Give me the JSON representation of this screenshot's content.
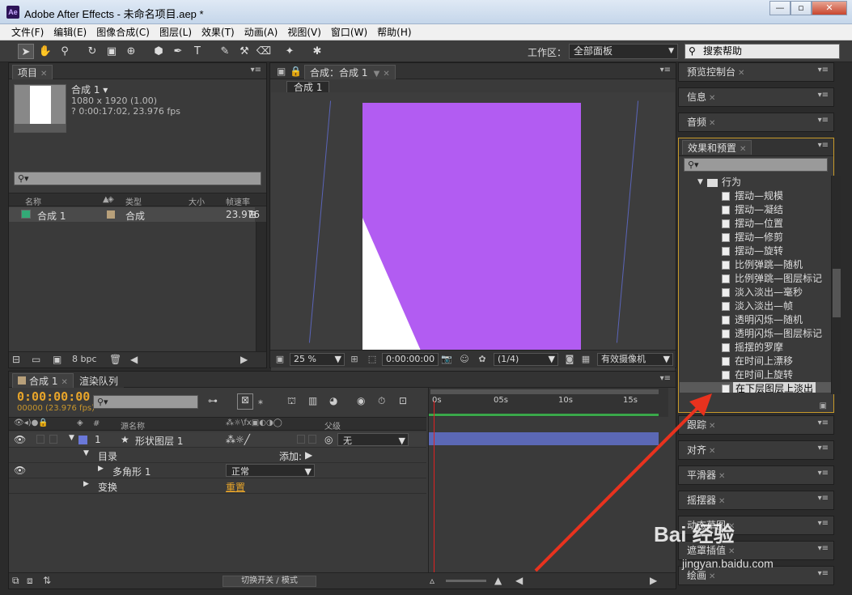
{
  "window": {
    "title": "Adobe After Effects - 未命名项目.aep *",
    "icon": "Ae"
  },
  "menu": [
    "文件(F)",
    "编辑(E)",
    "图像合成(C)",
    "图层(L)",
    "效果(T)",
    "动画(A)",
    "视图(V)",
    "窗口(W)",
    "帮助(H)"
  ],
  "toolbar": {
    "workspace_label": "工作区：",
    "workspace_value": "全部面板",
    "help_search": "搜索帮助"
  },
  "project": {
    "tab": "项目",
    "comp_name": "合成 1 ▾",
    "resolution": "1080 x 1920 (1.00)",
    "duration": "? 0:00:17:02, 23.976 fps",
    "columns": {
      "name": "名称",
      "type": "类型",
      "size": "大小",
      "fps": "帧速率"
    },
    "rows": [
      {
        "name": "合成 1",
        "type": "合成",
        "fps": "23.976"
      }
    ],
    "bpc": "8 bpc"
  },
  "composition": {
    "tab": "合成：合成 1",
    "subtab": "合成 1",
    "zoom": "25 %",
    "timecode": "0:00:00:00",
    "resolution": "(1/4)",
    "camera": "有效摄像机",
    "bg_color": "#b25cf2"
  },
  "right_panels": {
    "preview": "预览控制台",
    "info": "信息",
    "audio": "音频",
    "effects": "效果和预置",
    "tracker": "跟踪",
    "align": "对齐",
    "smoother": "平滑器",
    "wiggler": "摇摆器",
    "motion_sketch": "动态草图",
    "mask_interp": "遮罩插值",
    "paint": "绘画"
  },
  "effects": {
    "folder": "行为",
    "items": [
      "摆动—规模",
      "摆动—凝结",
      "摆动—位置",
      "摆动—修剪",
      "摆动—旋转",
      "比例弹跳—随机",
      "比例弹跳—图层标记",
      "淡入淡出—毫秒",
      "淡入淡出—帧",
      "透明闪烁—随机",
      "透明闪烁—图层标记",
      "摇摆的罗摩",
      "在时间上漂移",
      "在时间上旋转",
      "在下层图层上淡出"
    ],
    "selected_index": 14
  },
  "timeline": {
    "tab": "合成 1",
    "render_tab": "渲染队列",
    "timecode": "0:00:00:00",
    "frames": "00000 (23.976 fps)",
    "col_source": "源名称",
    "col_parent": "父级",
    "layer_num": "1",
    "layer_name": "形状图层 1",
    "parent_value": "无",
    "contents": "目录",
    "add_label": "添加:",
    "polygon": "多角形 1",
    "blend_mode": "正常",
    "transform": "变换",
    "reset": "重置",
    "toggle_label": "切换开关 / 模式",
    "ruler": [
      "0s",
      "05s",
      "10s",
      "15s"
    ]
  },
  "watermark": {
    "text": "Bai 经验",
    "url": "jingyan.baidu.com"
  }
}
